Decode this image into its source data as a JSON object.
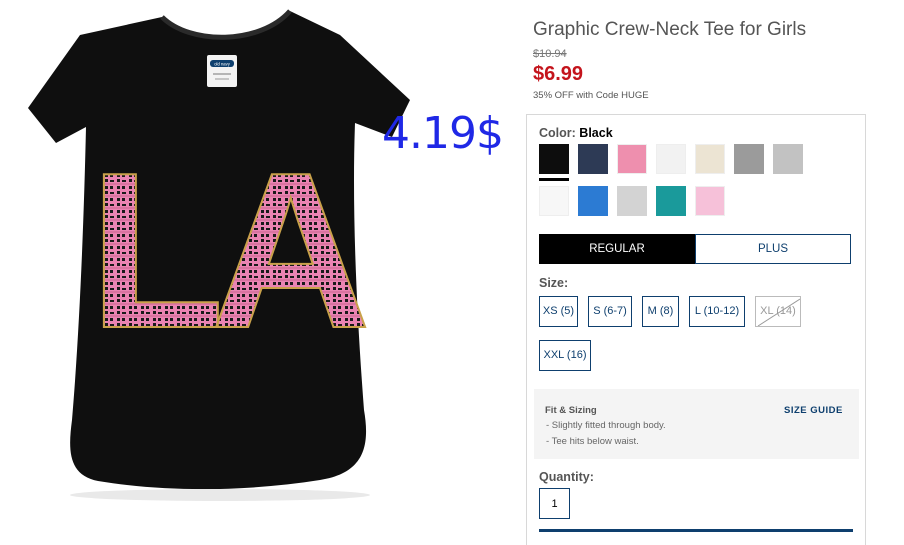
{
  "overlay_price": "4.19$",
  "product": {
    "title": "Graphic Crew-Neck Tee for Girls",
    "original_price": "$10.94",
    "sale_price": "$6.99",
    "promo": "35% OFF with Code HUGE",
    "image_print_text": "LA",
    "tag_text": "old navy"
  },
  "color": {
    "label": "Color:",
    "selected": "Black",
    "swatches": [
      {
        "name": "black",
        "hex": "#0d0d0d"
      },
      {
        "name": "navy",
        "hex": "#2d3a55"
      },
      {
        "name": "pink",
        "hex": "#ee8fae"
      },
      {
        "name": "white-heather",
        "hex": "#f2f2f2"
      },
      {
        "name": "oatmeal",
        "hex": "#ece4d3"
      },
      {
        "name": "dark-gray",
        "hex": "#9b9b9b"
      },
      {
        "name": "light-gray",
        "hex": "#c2c2c2"
      },
      {
        "name": "white",
        "hex": "#f7f7f7"
      },
      {
        "name": "blue",
        "hex": "#2c7bd3"
      },
      {
        "name": "gray-heather",
        "hex": "#d3d3d3"
      },
      {
        "name": "teal",
        "hex": "#1a9a9b"
      },
      {
        "name": "light-pink",
        "hex": "#f6c1d9"
      }
    ]
  },
  "fit_options": {
    "regular": "REGULAR",
    "plus": "PLUS",
    "selected": "REGULAR"
  },
  "size": {
    "label": "Size:",
    "options": [
      {
        "label": "XS (5)",
        "available": true
      },
      {
        "label": "S (6-7)",
        "available": true
      },
      {
        "label": "M (8)",
        "available": true
      },
      {
        "label": "L (10-12)",
        "available": true
      },
      {
        "label": "XL (14)",
        "available": false
      },
      {
        "label": "XXL (16)",
        "available": true
      }
    ]
  },
  "fit_sizing": {
    "heading": "Fit & Sizing",
    "guide_link": "SIZE GUIDE",
    "notes": [
      "- Slightly fitted through body.",
      "- Tee hits below waist."
    ]
  },
  "quantity": {
    "label": "Quantity:",
    "value": "1"
  },
  "colors": {
    "accent": "#0e3f6e",
    "sale": "#c4141c",
    "overlay": "#1f28e6",
    "print_pink": "#ea84b2",
    "print_gold": "#c9a14a"
  }
}
